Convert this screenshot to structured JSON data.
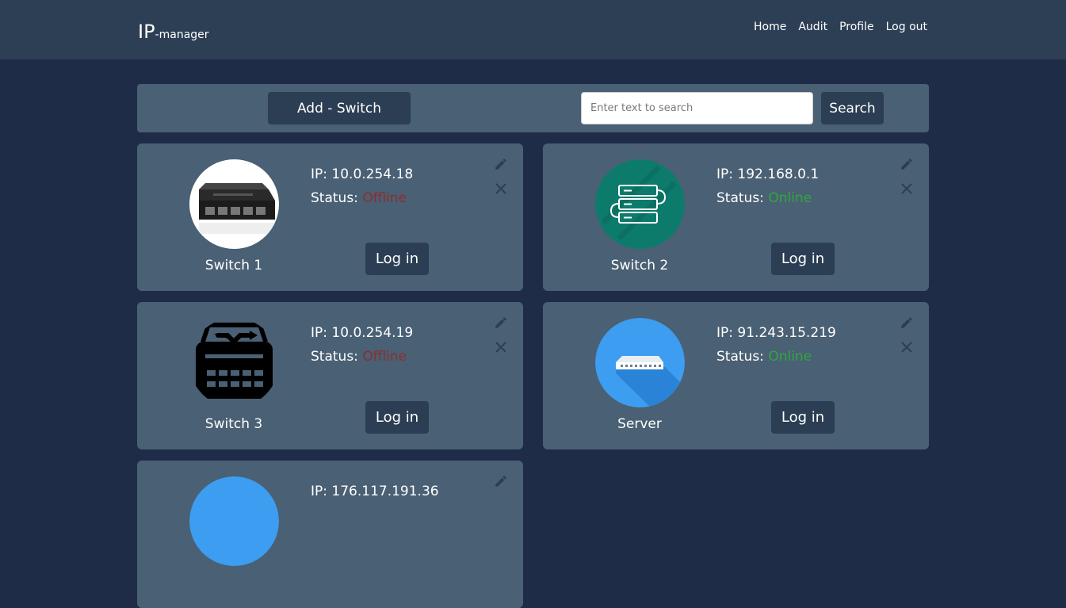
{
  "navbar": {
    "brand_main": "IP",
    "brand_sub": "-manager",
    "links": [
      "Home",
      "Audit",
      "Profile",
      "Log out"
    ]
  },
  "toolbar": {
    "add_label": "Add - Switch",
    "search_placeholder": "Enter text to search",
    "search_label": "Search"
  },
  "labels": {
    "ip_prefix": "IP: ",
    "status_prefix": "Status: ",
    "login": "Log in"
  },
  "devices": [
    {
      "name": "Switch 1",
      "ip": "10.0.254.18",
      "status": "Offline",
      "icon": "dlink-switch-photo"
    },
    {
      "name": "Switch 2",
      "ip": "192.168.0.1",
      "status": "Online",
      "icon": "server-rack-icon"
    },
    {
      "name": "Switch 3",
      "ip": "10.0.254.19",
      "status": "Offline",
      "icon": "network-switch-icon"
    },
    {
      "name": "Server",
      "ip": "91.243.15.219",
      "status": "Online",
      "icon": "router-flat-icon"
    },
    {
      "name": "",
      "ip": "176.117.191.36",
      "status": "",
      "icon": "blue-circle-icon"
    }
  ],
  "colors": {
    "background": "#1e2c47",
    "navbar": "#2c3f54",
    "card": "#4a6074",
    "button": "#2b3e53",
    "offline": "#8b2f2f",
    "online": "#2ea83c"
  }
}
